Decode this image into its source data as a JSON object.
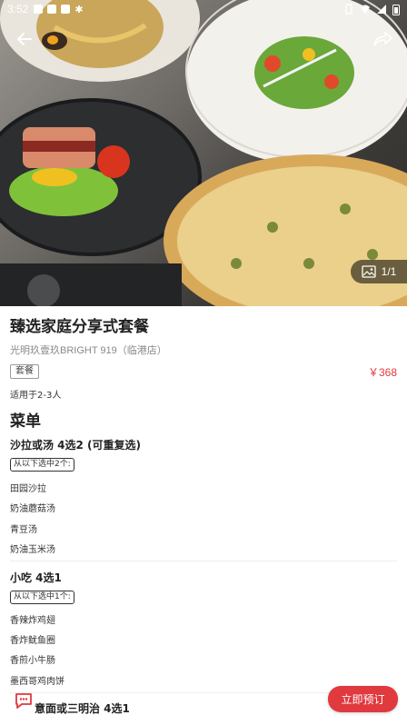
{
  "status_bar": {
    "time": "3:52"
  },
  "hero": {
    "photo_counter": "1/1"
  },
  "package": {
    "title": "臻选家庭分享式套餐",
    "store": "光明玖壹玖BRIGHT 919（临港店）",
    "tag": "套餐",
    "price": "￥368",
    "suitable": "适用于2-3人"
  },
  "menu": {
    "title": "菜单",
    "sections": [
      {
        "title": "沙拉或汤 4选2 (可重复选)",
        "choose": "从以下选中2个:",
        "items": [
          "田园沙拉",
          "奶油蘑菇汤",
          "青豆汤",
          "奶油玉米汤"
        ]
      },
      {
        "title": "小吃 4选1",
        "choose": "从以下选中1个:",
        "items": [
          "香辣炸鸡翅",
          "香炸鱿鱼圈",
          "香煎小牛肠",
          "墨西哥鸡肉饼"
        ]
      },
      {
        "title": "意面或三明治 4选1"
      }
    ]
  },
  "footer": {
    "reserve_label": "立即预订"
  },
  "colors": {
    "accent": "#e0393e"
  }
}
